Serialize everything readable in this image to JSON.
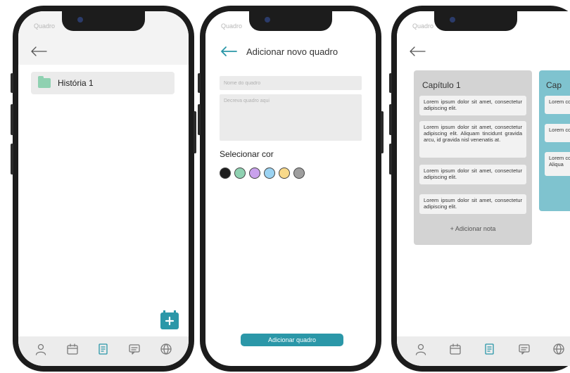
{
  "statusbar": {
    "app_title": "Quadro"
  },
  "screen_board_list": {
    "boards": [
      {
        "label": "História 1"
      }
    ]
  },
  "screen_new_board": {
    "title": "Adicionar novo quadro",
    "name_placeholder": "Nome do quadro",
    "description_placeholder": "Decreva quadro aqui",
    "color_label": "Selecionar cor",
    "colors": [
      "#1e1e1e",
      "#8fd1b1",
      "#c9a1ec",
      "#9bd3f2",
      "#f8d98a",
      "#9e9e9e"
    ],
    "submit_label": "Adicionar quadro"
  },
  "screen_board_detail": {
    "columns": [
      {
        "title": "Capítulo 1",
        "notes": [
          "Lorem ipsum dolor sit amet, consectetur adipiscing elit.",
          "Lorem ipsum dolor sit amet, consectetur adipiscing elit. Aliquam tincidunt gravida arcu, id gravida nisl venenatis at.",
          "Lorem ipsum dolor sit amet, consectetur adipiscing elit.",
          "Lorem ipsum dolor sit amet, consectetur adipiscing elit."
        ],
        "add_note_label": "+ Adicionar nota"
      },
      {
        "title": "Cap",
        "notes": [
          "Lorem conse",
          "Lorem cons",
          "Lorem conse Aliqua"
        ]
      }
    ]
  },
  "bottom_nav": {
    "items": [
      "person-icon",
      "calendar-icon",
      "board-icon",
      "chat-icon",
      "globe-icon"
    ],
    "active": "board-icon",
    "active_color": "#2b97a8",
    "inactive_color": "#7a7a7a"
  },
  "accent_color": "#2b97a8"
}
